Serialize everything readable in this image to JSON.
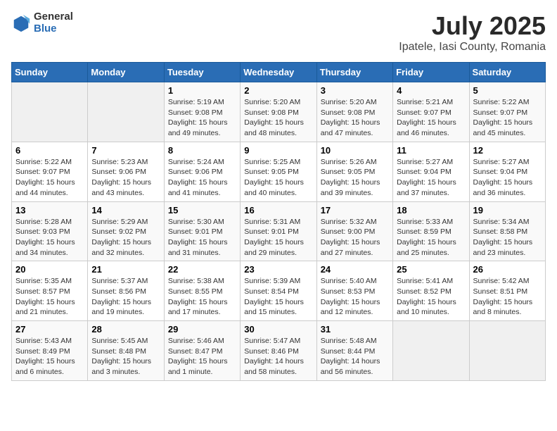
{
  "header": {
    "logo_general": "General",
    "logo_blue": "Blue",
    "title": "July 2025",
    "subtitle": "Ipatele, Iasi County, Romania"
  },
  "weekdays": [
    "Sunday",
    "Monday",
    "Tuesday",
    "Wednesday",
    "Thursday",
    "Friday",
    "Saturday"
  ],
  "weeks": [
    [
      {
        "day": "",
        "sunrise": "",
        "sunset": "",
        "daylight": ""
      },
      {
        "day": "",
        "sunrise": "",
        "sunset": "",
        "daylight": ""
      },
      {
        "day": "1",
        "sunrise": "Sunrise: 5:19 AM",
        "sunset": "Sunset: 9:08 PM",
        "daylight": "Daylight: 15 hours and 49 minutes."
      },
      {
        "day": "2",
        "sunrise": "Sunrise: 5:20 AM",
        "sunset": "Sunset: 9:08 PM",
        "daylight": "Daylight: 15 hours and 48 minutes."
      },
      {
        "day": "3",
        "sunrise": "Sunrise: 5:20 AM",
        "sunset": "Sunset: 9:08 PM",
        "daylight": "Daylight: 15 hours and 47 minutes."
      },
      {
        "day": "4",
        "sunrise": "Sunrise: 5:21 AM",
        "sunset": "Sunset: 9:07 PM",
        "daylight": "Daylight: 15 hours and 46 minutes."
      },
      {
        "day": "5",
        "sunrise": "Sunrise: 5:22 AM",
        "sunset": "Sunset: 9:07 PM",
        "daylight": "Daylight: 15 hours and 45 minutes."
      }
    ],
    [
      {
        "day": "6",
        "sunrise": "Sunrise: 5:22 AM",
        "sunset": "Sunset: 9:07 PM",
        "daylight": "Daylight: 15 hours and 44 minutes."
      },
      {
        "day": "7",
        "sunrise": "Sunrise: 5:23 AM",
        "sunset": "Sunset: 9:06 PM",
        "daylight": "Daylight: 15 hours and 43 minutes."
      },
      {
        "day": "8",
        "sunrise": "Sunrise: 5:24 AM",
        "sunset": "Sunset: 9:06 PM",
        "daylight": "Daylight: 15 hours and 41 minutes."
      },
      {
        "day": "9",
        "sunrise": "Sunrise: 5:25 AM",
        "sunset": "Sunset: 9:05 PM",
        "daylight": "Daylight: 15 hours and 40 minutes."
      },
      {
        "day": "10",
        "sunrise": "Sunrise: 5:26 AM",
        "sunset": "Sunset: 9:05 PM",
        "daylight": "Daylight: 15 hours and 39 minutes."
      },
      {
        "day": "11",
        "sunrise": "Sunrise: 5:27 AM",
        "sunset": "Sunset: 9:04 PM",
        "daylight": "Daylight: 15 hours and 37 minutes."
      },
      {
        "day": "12",
        "sunrise": "Sunrise: 5:27 AM",
        "sunset": "Sunset: 9:04 PM",
        "daylight": "Daylight: 15 hours and 36 minutes."
      }
    ],
    [
      {
        "day": "13",
        "sunrise": "Sunrise: 5:28 AM",
        "sunset": "Sunset: 9:03 PM",
        "daylight": "Daylight: 15 hours and 34 minutes."
      },
      {
        "day": "14",
        "sunrise": "Sunrise: 5:29 AM",
        "sunset": "Sunset: 9:02 PM",
        "daylight": "Daylight: 15 hours and 32 minutes."
      },
      {
        "day": "15",
        "sunrise": "Sunrise: 5:30 AM",
        "sunset": "Sunset: 9:01 PM",
        "daylight": "Daylight: 15 hours and 31 minutes."
      },
      {
        "day": "16",
        "sunrise": "Sunrise: 5:31 AM",
        "sunset": "Sunset: 9:01 PM",
        "daylight": "Daylight: 15 hours and 29 minutes."
      },
      {
        "day": "17",
        "sunrise": "Sunrise: 5:32 AM",
        "sunset": "Sunset: 9:00 PM",
        "daylight": "Daylight: 15 hours and 27 minutes."
      },
      {
        "day": "18",
        "sunrise": "Sunrise: 5:33 AM",
        "sunset": "Sunset: 8:59 PM",
        "daylight": "Daylight: 15 hours and 25 minutes."
      },
      {
        "day": "19",
        "sunrise": "Sunrise: 5:34 AM",
        "sunset": "Sunset: 8:58 PM",
        "daylight": "Daylight: 15 hours and 23 minutes."
      }
    ],
    [
      {
        "day": "20",
        "sunrise": "Sunrise: 5:35 AM",
        "sunset": "Sunset: 8:57 PM",
        "daylight": "Daylight: 15 hours and 21 minutes."
      },
      {
        "day": "21",
        "sunrise": "Sunrise: 5:37 AM",
        "sunset": "Sunset: 8:56 PM",
        "daylight": "Daylight: 15 hours and 19 minutes."
      },
      {
        "day": "22",
        "sunrise": "Sunrise: 5:38 AM",
        "sunset": "Sunset: 8:55 PM",
        "daylight": "Daylight: 15 hours and 17 minutes."
      },
      {
        "day": "23",
        "sunrise": "Sunrise: 5:39 AM",
        "sunset": "Sunset: 8:54 PM",
        "daylight": "Daylight: 15 hours and 15 minutes."
      },
      {
        "day": "24",
        "sunrise": "Sunrise: 5:40 AM",
        "sunset": "Sunset: 8:53 PM",
        "daylight": "Daylight: 15 hours and 12 minutes."
      },
      {
        "day": "25",
        "sunrise": "Sunrise: 5:41 AM",
        "sunset": "Sunset: 8:52 PM",
        "daylight": "Daylight: 15 hours and 10 minutes."
      },
      {
        "day": "26",
        "sunrise": "Sunrise: 5:42 AM",
        "sunset": "Sunset: 8:51 PM",
        "daylight": "Daylight: 15 hours and 8 minutes."
      }
    ],
    [
      {
        "day": "27",
        "sunrise": "Sunrise: 5:43 AM",
        "sunset": "Sunset: 8:49 PM",
        "daylight": "Daylight: 15 hours and 6 minutes."
      },
      {
        "day": "28",
        "sunrise": "Sunrise: 5:45 AM",
        "sunset": "Sunset: 8:48 PM",
        "daylight": "Daylight: 15 hours and 3 minutes."
      },
      {
        "day": "29",
        "sunrise": "Sunrise: 5:46 AM",
        "sunset": "Sunset: 8:47 PM",
        "daylight": "Daylight: 15 hours and 1 minute."
      },
      {
        "day": "30",
        "sunrise": "Sunrise: 5:47 AM",
        "sunset": "Sunset: 8:46 PM",
        "daylight": "Daylight: 14 hours and 58 minutes."
      },
      {
        "day": "31",
        "sunrise": "Sunrise: 5:48 AM",
        "sunset": "Sunset: 8:44 PM",
        "daylight": "Daylight: 14 hours and 56 minutes."
      },
      {
        "day": "",
        "sunrise": "",
        "sunset": "",
        "daylight": ""
      },
      {
        "day": "",
        "sunrise": "",
        "sunset": "",
        "daylight": ""
      }
    ]
  ]
}
